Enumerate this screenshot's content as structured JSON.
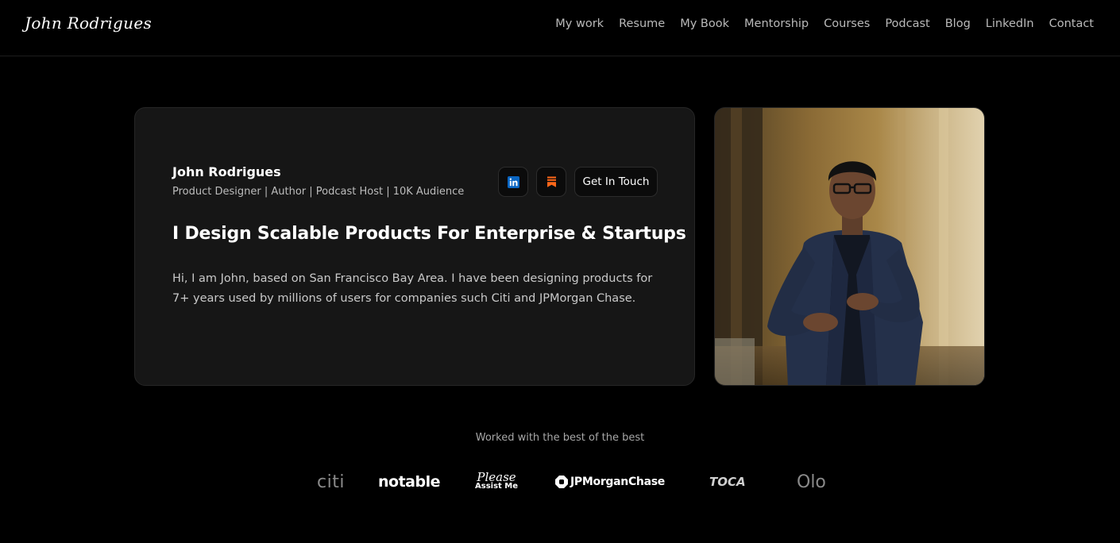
{
  "brand": {
    "logo_text": "John Rodrigues"
  },
  "nav": {
    "links": [
      "My work",
      "Resume",
      "My Book",
      "Mentorship",
      "Courses",
      "Podcast",
      "Blog",
      "LinkedIn",
      "Contact"
    ]
  },
  "hero": {
    "name": "John Rodrigues",
    "tagline": "Product Designer | Author | Podcast Host | 10K Audience",
    "headline": "I Design Scalable Products For Enterprise & Startups",
    "bio": "Hi, I am John, based on San Francisco Bay Area. I have been designing products for 7+ years used by millions of users for companies such Citi and JPMorgan Chase.",
    "cta_label": "Get In Touch",
    "icons": {
      "linkedin": "linkedin-icon",
      "substack": "substack-icon"
    }
  },
  "clients": {
    "title": "Worked with the best of the best",
    "logos": [
      {
        "label": "citi"
      },
      {
        "label": "notable"
      },
      {
        "label_line1": "Please",
        "label_line2": "Assist Me"
      },
      {
        "label": "JPMorganChase"
      },
      {
        "label": "TOCA"
      },
      {
        "label": "Olo"
      }
    ]
  },
  "colors": {
    "background": "#000000",
    "card": "#161616",
    "linkedin": "#0A66C2",
    "substack": "#FF6719"
  }
}
